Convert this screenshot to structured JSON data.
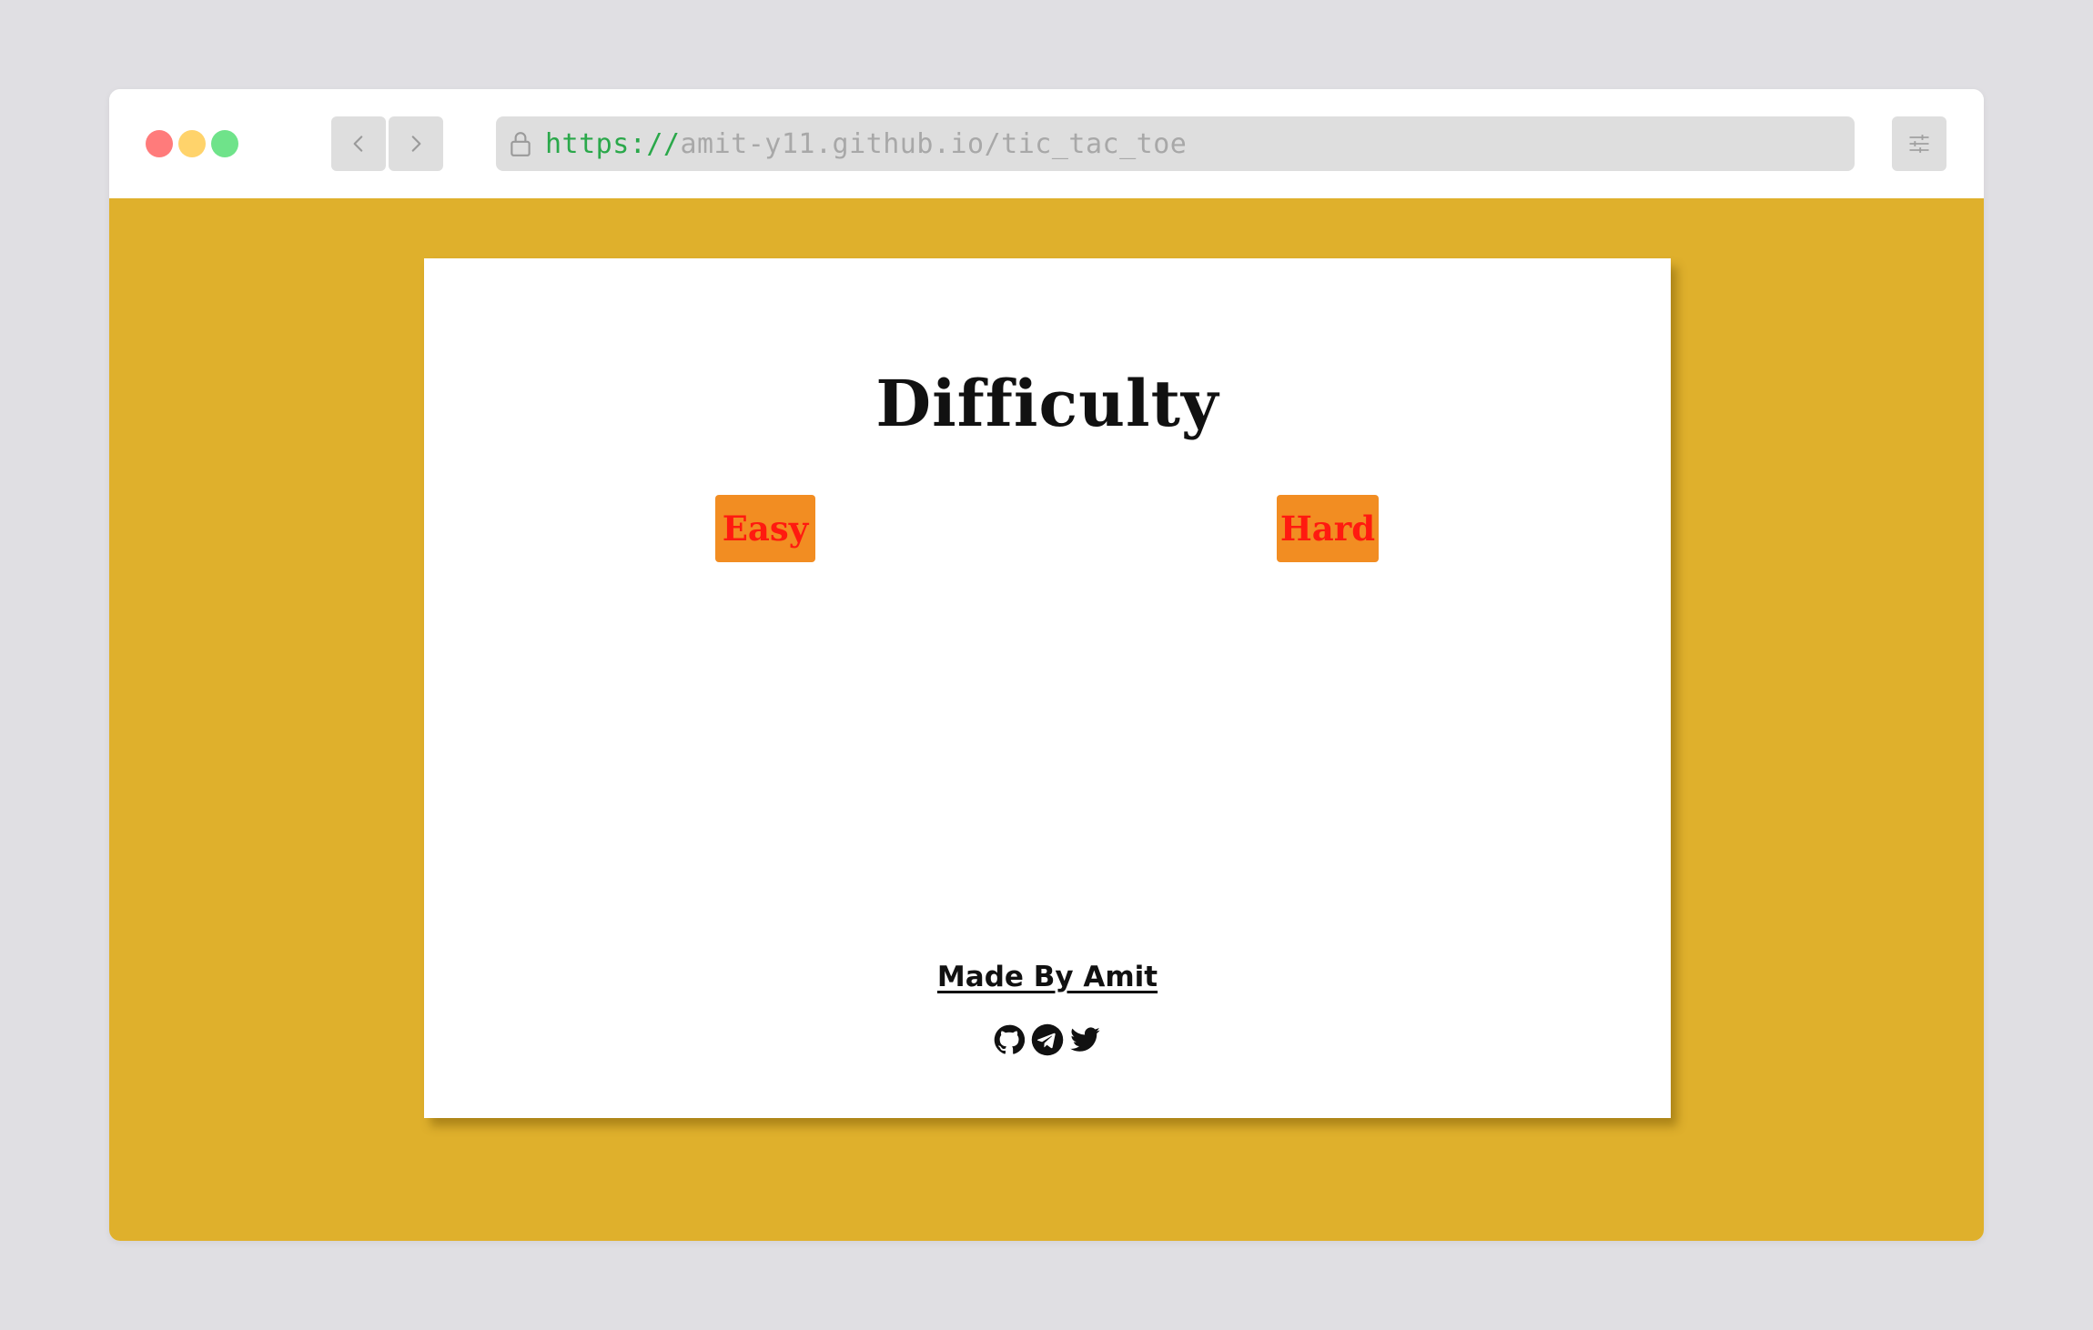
{
  "browser": {
    "url_scheme": "https://",
    "url_rest": "amit-y11.github.io/tic_tac_toe",
    "traffic_lights": [
      "close",
      "minimize",
      "maximize"
    ],
    "nav_icons": [
      "chevron-left-icon",
      "chevron-right-icon"
    ],
    "menu_icon": "sliders-icon"
  },
  "page": {
    "background_color": "#dfb02c",
    "title": "Difficulty",
    "buttons": {
      "easy": "Easy",
      "hard": "Hard"
    },
    "button_color": "#f28d22",
    "button_text_color": "#ff1a10",
    "credit": "Made By Amit",
    "socials": [
      "github-icon",
      "telegram-icon",
      "twitter-icon"
    ]
  }
}
